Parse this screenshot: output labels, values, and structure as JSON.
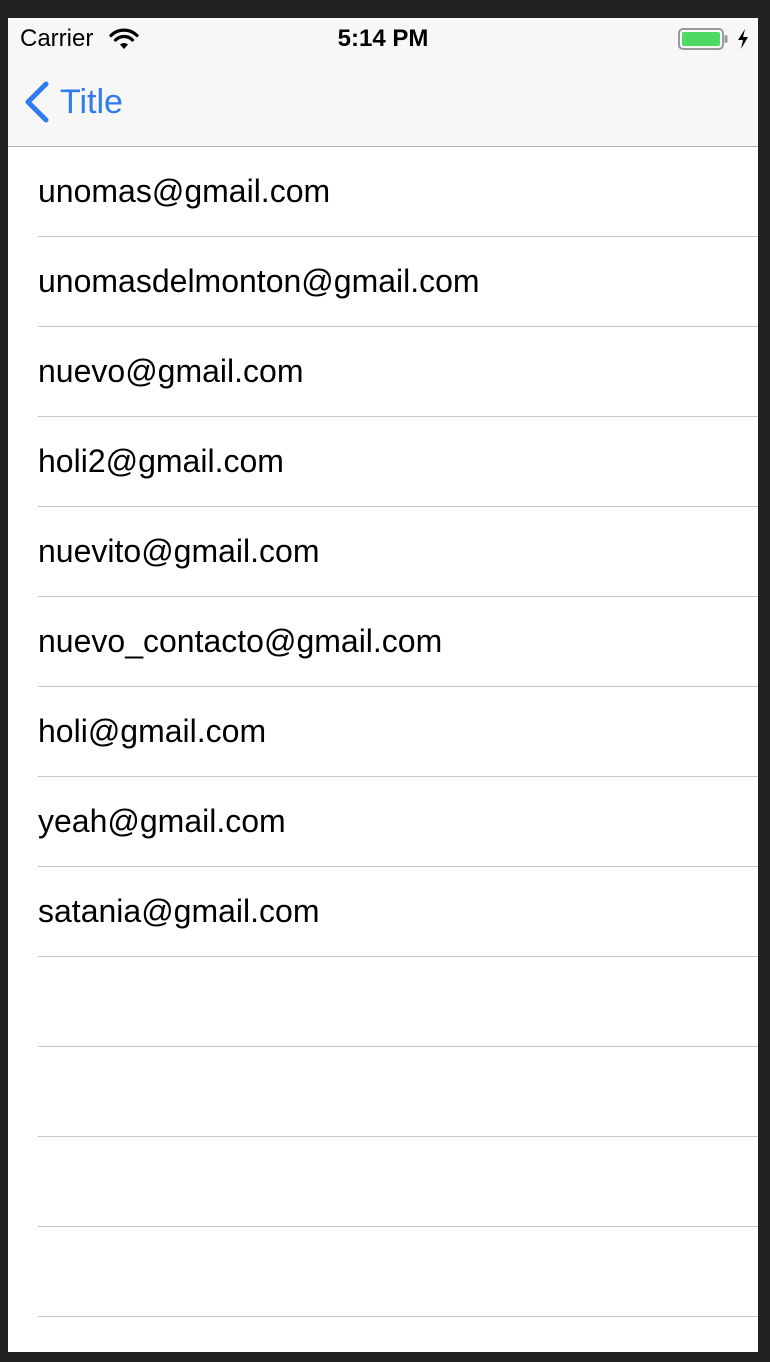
{
  "status_bar": {
    "carrier": "Carrier",
    "time": "5:14 PM",
    "wifi_icon": "wifi-icon",
    "battery_icon": "battery-charging-icon",
    "battery_color": "#4cd964"
  },
  "nav_bar": {
    "back_label": "Title",
    "back_icon": "chevron-left-icon",
    "tint_color": "#2f7bf2"
  },
  "contacts": [
    "unomas@gmail.com",
    "unomasdelmonton@gmail.com",
    "nuevo@gmail.com",
    "holi2@gmail.com",
    "nuevito@gmail.com",
    "nuevo_contacto@gmail.com",
    "holi@gmail.com",
    "yeah@gmail.com",
    "satania@gmail.com",
    "",
    "",
    "",
    ""
  ]
}
